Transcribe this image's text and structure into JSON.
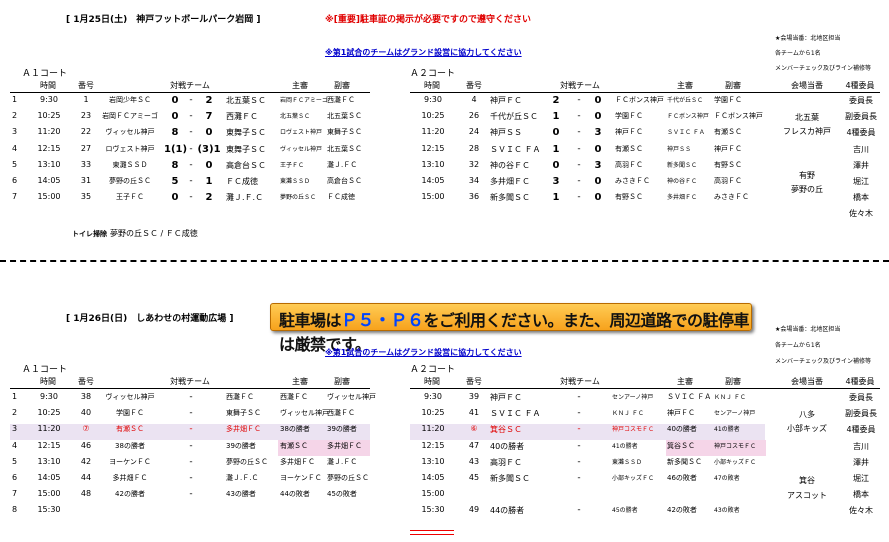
{
  "day1": {
    "title": "[ 1月25日(土)　神戸フットボールパーク岩岡 ]",
    "notice": "※[重要]駐車証の掲示が必要ですので遵守ください",
    "firstmatch": "※第1試合のチームはグランド設営に協力してください",
    "meeting": "★会場当番：北地区担当",
    "perteam": "各チームから1名",
    "member": "メンバーチェック及びライン補修等",
    "courtA": "Ａ１コート",
    "courtB": "Ａ２コート",
    "hdr": {
      "time": "時間",
      "num": "番号",
      "match": "対戦チーム",
      "ref": "主審",
      "sub": "副審",
      "duty": "会場当番",
      "four": "4種委員"
    },
    "rowsA": [
      [
        "1",
        "9:30",
        "1",
        "岩岡少年ＳＣ",
        "0",
        "-",
        "2",
        "北五葉ＳＣ",
        "岩岡ＦＣアミーゴ",
        "西灘ＦＣ"
      ],
      [
        "2",
        "10:25",
        "23",
        "岩岡ＦＣアミーゴ",
        "0",
        "-",
        "7",
        "西灘ＦＣ",
        "北五葉ＳＣ",
        "北五葉ＳＣ"
      ],
      [
        "3",
        "11:20",
        "22",
        "ヴィッセル神戸",
        "8",
        "-",
        "0",
        "東舞子ＳＣ",
        "ロヴェスト神戸",
        "東舞子ＳＣ"
      ],
      [
        "4",
        "12:15",
        "27",
        "ロヴェスト神戸",
        "1(1)",
        "-",
        "(3)1",
        "東舞子ＳＣ",
        "ヴィッセル神戸",
        "北五葉ＳＣ"
      ],
      [
        "5",
        "13:10",
        "33",
        "東灘ＳＳＤ",
        "8",
        "-",
        "0",
        "高倉台ＳＣ",
        "王子ＦＣ",
        "灘Ｊ.ＦＣ"
      ],
      [
        "6",
        "14:05",
        "31",
        "夢野の丘ＳＣ",
        "5",
        "-",
        "1",
        "ＦＣ成徳",
        "東灘ＳＳＤ",
        "高倉台ＳＣ"
      ],
      [
        "7",
        "15:00",
        "35",
        "王子ＦＣ",
        "0",
        "-",
        "2",
        "灘Ｊ.Ｆ.Ｃ",
        "夢野の丘ＳＣ",
        "ＦＣ成徳"
      ]
    ],
    "rowsB": [
      [
        "9:30",
        "4",
        "神戸ＦＣ",
        "2",
        "-",
        "0",
        "ＦＣボンス神戸",
        "千代が丘ＳＣ",
        "学園ＦＣ"
      ],
      [
        "10:25",
        "26",
        "千代が丘ＳＣ",
        "1",
        "-",
        "0",
        "学園ＦＣ",
        "ＦＣボンス神戸",
        "ＦＣボンス神戸"
      ],
      [
        "11:20",
        "24",
        "神戸ＳＳ",
        "0",
        "-",
        "3",
        "神戸ＦＣ",
        "ＳＶＩＣ ＦＡ",
        "有瀬ＳＣ"
      ],
      [
        "12:15",
        "28",
        "ＳＶＩＣ ＦＡ",
        "1",
        "-",
        "0",
        "有瀬ＳＣ",
        "神戸ＳＳ",
        "神戸ＦＣ"
      ],
      [
        "13:10",
        "32",
        "神の谷ＦＣ",
        "0",
        "-",
        "3",
        "高羽ＦＣ",
        "新多聞ＳＣ",
        "有野ＳＣ"
      ],
      [
        "14:05",
        "34",
        "多井畑ＦＣ",
        "3",
        "-",
        "0",
        "みさきＦＣ",
        "神の谷ＦＣ",
        "高羽ＦＣ"
      ],
      [
        "15:00",
        "36",
        "新多聞ＳＣ",
        "1",
        "-",
        "0",
        "有野ＳＣ",
        "多井畑ＦＣ",
        "みさきＦＣ"
      ]
    ],
    "duty": [
      "北五葉",
      "フレスカ神戸",
      "有野",
      "夢野の丘"
    ],
    "four": [
      "委員長",
      "副委員長",
      "4種委員",
      "吉川",
      "澤井",
      "堀江",
      "橋本",
      "佐々木"
    ],
    "toilet_label": "トイレ掃除",
    "toilet_value": "夢野の丘ＳＣ / ＦＣ成徳"
  },
  "day2": {
    "title": "[ 1月26日(日)　しあわせの村運動広場 ]",
    "banner_a": "駐車場は",
    "banner_hl": "Ｐ５・Ｐ６",
    "banner_b": "をご利用ください。また、周辺道路での駐停車は厳禁です。",
    "firstmatch": "※第1試合のチームはグランド設営に協力してください",
    "meeting": "★会場当番：北地区担当",
    "perteam": "各チームから1名",
    "member": "メンバーチェック及びライン補修等",
    "courtA": "Ａ１コート",
    "courtB": "Ａ２コート",
    "rowsA": [
      [
        "1",
        "9:30",
        "38",
        "ヴィッセル神戸",
        "-",
        "西灘ＦＣ",
        "西灘ＦＣ",
        "ヴィッセル神戸"
      ],
      [
        "2",
        "10:25",
        "40",
        "学園ＦＣ",
        "-",
        "東舞子ＳＣ",
        "ヴィッセル神戸",
        "西灘ＦＣ"
      ],
      [
        "3",
        "11:20",
        "⑦",
        "有瀬ＳＣ",
        "-",
        "多井畑ＦＣ",
        "38の勝者",
        "39の勝者"
      ],
      [
        "4",
        "12:15",
        "46",
        "38の勝者",
        "-",
        "39の勝者",
        "有瀬ＳＣ",
        "多井畑ＦＣ"
      ],
      [
        "5",
        "13:10",
        "42",
        "ヨーケンＦＣ",
        "-",
        "夢野の丘ＳＣ",
        "多井畑ＦＣ",
        "灘Ｊ.ＦＣ"
      ],
      [
        "6",
        "14:05",
        "44",
        "多井畑ＦＣ",
        "-",
        "灘Ｊ.Ｆ.Ｃ",
        "ヨーケンＦＣ",
        "夢野の丘ＳＣ"
      ],
      [
        "7",
        "15:00",
        "48",
        "42の勝者",
        "-",
        "43の勝者",
        "44の敗者",
        "45の敗者"
      ],
      [
        "8",
        "15:30",
        "",
        "",
        "",
        "",
        "",
        ""
      ]
    ],
    "rowsB": [
      [
        "9:30",
        "39",
        "神戸ＦＣ",
        "-",
        "センアーノ神戸",
        "ＳＶＩＣ ＦＡ",
        "ＫＮＪ ＦＣ"
      ],
      [
        "10:25",
        "41",
        "ＳＶＩＣ ＦＡ",
        "-",
        "ＫＮＪ ＦＣ",
        "神戸ＦＣ",
        "センアーノ神戸"
      ],
      [
        "11:20",
        "⑥",
        "箕谷ＳＣ",
        "-",
        "神戸コスモＦＣ",
        "40の勝者",
        "41の勝者"
      ],
      [
        "12:15",
        "47",
        "40の勝者",
        "-",
        "41の勝者",
        "箕谷ＳＣ",
        "神戸コスモＦＣ"
      ],
      [
        "13:10",
        "43",
        "高羽ＦＣ",
        "-",
        "東灘ＳＳＤ",
        "新多聞ＳＣ",
        "小部キッズＦＣ"
      ],
      [
        "14:05",
        "45",
        "新多聞ＳＣ",
        "-",
        "小部キッズＦＣ",
        "46の敗者",
        "47の敗者"
      ],
      [
        "15:00",
        "",
        "",
        "",
        "",
        "",
        ""
      ],
      [
        "15:30",
        "49",
        "44の勝者",
        "-",
        "45の勝者",
        "42の敗者",
        "43の敗者"
      ]
    ],
    "duty": [
      "八多",
      "小部キッズ",
      "箕谷",
      "アスコット"
    ],
    "four": [
      "委員長",
      "副委員長",
      "4種委員",
      "吉川",
      "澤井",
      "堀江",
      "橋本",
      "佐々木"
    ]
  }
}
